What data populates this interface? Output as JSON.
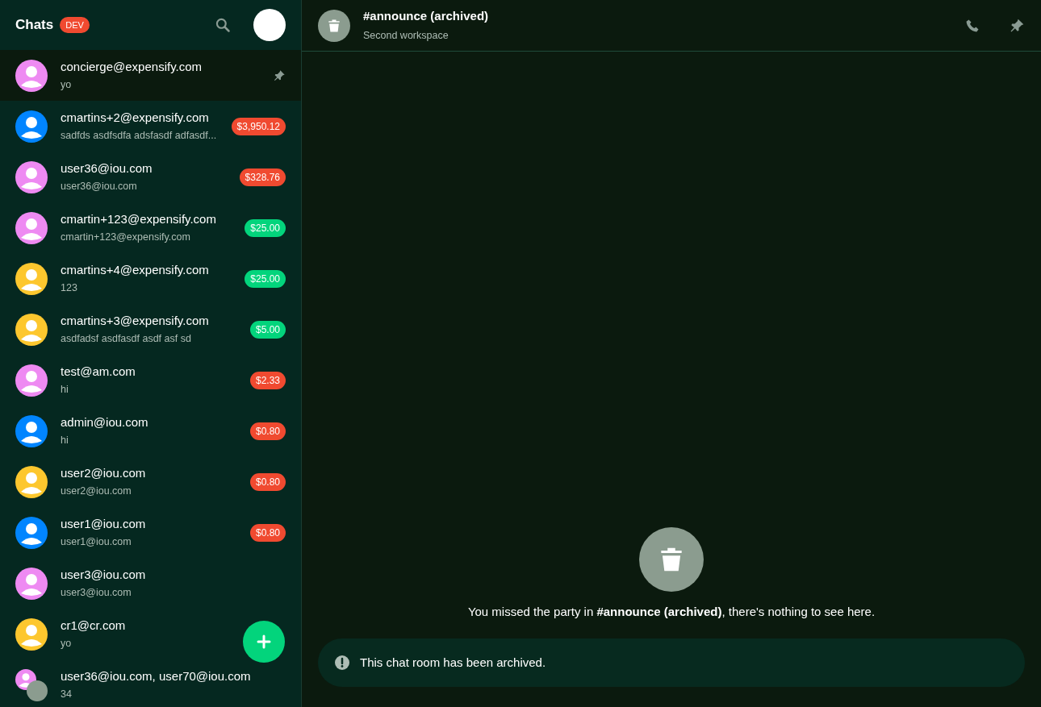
{
  "sidebar": {
    "title": "Chats",
    "env_badge": "DEV",
    "chats": [
      {
        "name": "concierge@expensify.com",
        "preview": "yo",
        "selected": true,
        "pinned": true,
        "avatar": {
          "kind": "single",
          "color": "#ee8af2"
        }
      },
      {
        "name": "cmartins+2@expensify.com",
        "preview": "sadfds asdfsdfa adsfasdf adfasdf...",
        "selected": false,
        "pinned": false,
        "avatar": {
          "kind": "single",
          "color": "#0185ff"
        },
        "amount": {
          "text": "$3,950.12",
          "color": "#f04a30"
        }
      },
      {
        "name": "user36@iou.com",
        "preview": "user36@iou.com",
        "selected": false,
        "pinned": false,
        "avatar": {
          "kind": "single",
          "color": "#ee8af2"
        },
        "amount": {
          "text": "$328.76",
          "color": "#f04a30"
        }
      },
      {
        "name": "cmartin+123@expensify.com",
        "preview": "cmartin+123@expensify.com",
        "selected": false,
        "pinned": false,
        "avatar": {
          "kind": "single",
          "color": "#ee8af2"
        },
        "amount": {
          "text": "$25.00",
          "color": "#03d47c"
        }
      },
      {
        "name": "cmartins+4@expensify.com",
        "preview": "123",
        "selected": false,
        "pinned": false,
        "avatar": {
          "kind": "single",
          "color": "#fdc72e"
        },
        "amount": {
          "text": "$25.00",
          "color": "#03d47c"
        }
      },
      {
        "name": "cmartins+3@expensify.com",
        "preview": "asdfadsf asdfasdf asdf asf sd",
        "selected": false,
        "pinned": false,
        "avatar": {
          "kind": "single",
          "color": "#fdc72e"
        },
        "amount": {
          "text": "$5.00",
          "color": "#03d47c"
        }
      },
      {
        "name": "test@am.com",
        "preview": "hi",
        "selected": false,
        "pinned": false,
        "avatar": {
          "kind": "single",
          "color": "#ee8af2"
        },
        "amount": {
          "text": "$2.33",
          "color": "#f04a30"
        }
      },
      {
        "name": "admin@iou.com",
        "preview": "hi",
        "selected": false,
        "pinned": false,
        "avatar": {
          "kind": "single",
          "color": "#0185ff"
        },
        "amount": {
          "text": "$0.80",
          "color": "#f04a30"
        }
      },
      {
        "name": "user2@iou.com",
        "preview": "user2@iou.com",
        "selected": false,
        "pinned": false,
        "avatar": {
          "kind": "single",
          "color": "#fdc72e"
        },
        "amount": {
          "text": "$0.80",
          "color": "#f04a30"
        }
      },
      {
        "name": "user1@iou.com",
        "preview": "user1@iou.com",
        "selected": false,
        "pinned": false,
        "avatar": {
          "kind": "single",
          "color": "#0185ff"
        },
        "amount": {
          "text": "$0.80",
          "color": "#f04a30"
        }
      },
      {
        "name": "user3@iou.com",
        "preview": "user3@iou.com",
        "selected": false,
        "pinned": false,
        "avatar": {
          "kind": "single",
          "color": "#ee8af2"
        }
      },
      {
        "name": "cr1@cr.com",
        "preview": "yo",
        "selected": false,
        "pinned": false,
        "avatar": {
          "kind": "single",
          "color": "#fdc72e"
        }
      },
      {
        "name": "user36@iou.com, user70@iou.com",
        "preview": "34",
        "selected": false,
        "pinned": false,
        "avatar": {
          "kind": "group",
          "color": "#ee8af2"
        }
      }
    ]
  },
  "chat": {
    "title": "#announce (archived)",
    "subtitle": "Second workspace",
    "empty_message": "You missed the party in **#announce (archived)**, there's nothing to see here.",
    "archived_notice": "This chat room has been archived."
  }
}
